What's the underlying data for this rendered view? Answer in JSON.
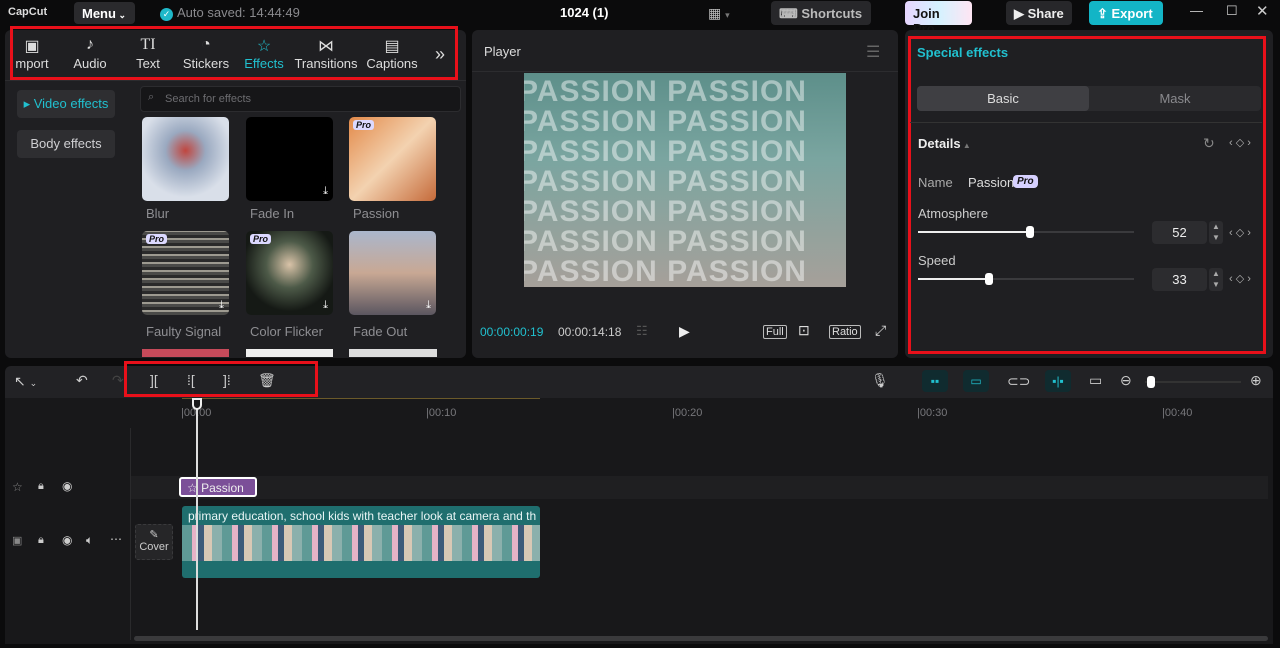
{
  "app": {
    "logo": "CapCut",
    "menu": "Menu",
    "autosave": "Auto saved: 14:44:49",
    "project_title": "1024 (1)",
    "shortcuts": "Shortcuts",
    "join_pro": "Join Pro",
    "share": "Share",
    "export": "Export"
  },
  "media_tabs": [
    {
      "label": "mport",
      "icon": "import-icon"
    },
    {
      "label": "Audio",
      "icon": "audio-icon"
    },
    {
      "label": "Text",
      "icon": "text-icon"
    },
    {
      "label": "Stickers",
      "icon": "stickers-icon"
    },
    {
      "label": "Effects",
      "icon": "effects-icon",
      "active": true
    },
    {
      "label": "Transitions",
      "icon": "transitions-icon"
    },
    {
      "label": "Captions",
      "icon": "captions-icon"
    }
  ],
  "effects": {
    "categories": [
      "▸ Video effects",
      "Body effects"
    ],
    "search_placeholder": "Search for effects",
    "items": [
      {
        "label": "Blur",
        "pro": false
      },
      {
        "label": "Fade In",
        "pro": false,
        "download": true
      },
      {
        "label": "Passion",
        "pro": true
      },
      {
        "label": "Faulty Signal",
        "pro": true,
        "download": true
      },
      {
        "label": "Color Flicker",
        "pro": true,
        "download": true
      },
      {
        "label": "Fade Out",
        "pro": false,
        "download": true
      }
    ],
    "pro_badge": "Pro"
  },
  "player": {
    "title": "Player",
    "overlay_text": "PASSION PASSION",
    "current_time": "00:00:00:19",
    "total_time": "00:00:14:18",
    "full": "Full",
    "ratio": "Ratio"
  },
  "inspector": {
    "title": "Special effects",
    "tabs": [
      "Basic",
      "Mask"
    ],
    "active_tab": "Basic",
    "section": "Details",
    "name_label": "Name",
    "name_value": "Passion",
    "pro_badge": "Pro",
    "params": [
      {
        "label": "Atmosphere",
        "value": "52",
        "percent": 52
      },
      {
        "label": "Speed",
        "value": "33",
        "percent": 33
      }
    ]
  },
  "timeline": {
    "ticks": [
      "|00:00",
      "|00:10",
      "|00:20",
      "|00:30",
      "|00:40"
    ],
    "effect_clip": "Passion",
    "video_clip": "primary education, school kids with teacher look at camera and th",
    "cover": "Cover"
  },
  "colors": {
    "accent": "#21c0cf",
    "highlight_box": "#e8101a",
    "effect_clip": "#7b4f98",
    "video_clip": "#1f6e6e"
  }
}
